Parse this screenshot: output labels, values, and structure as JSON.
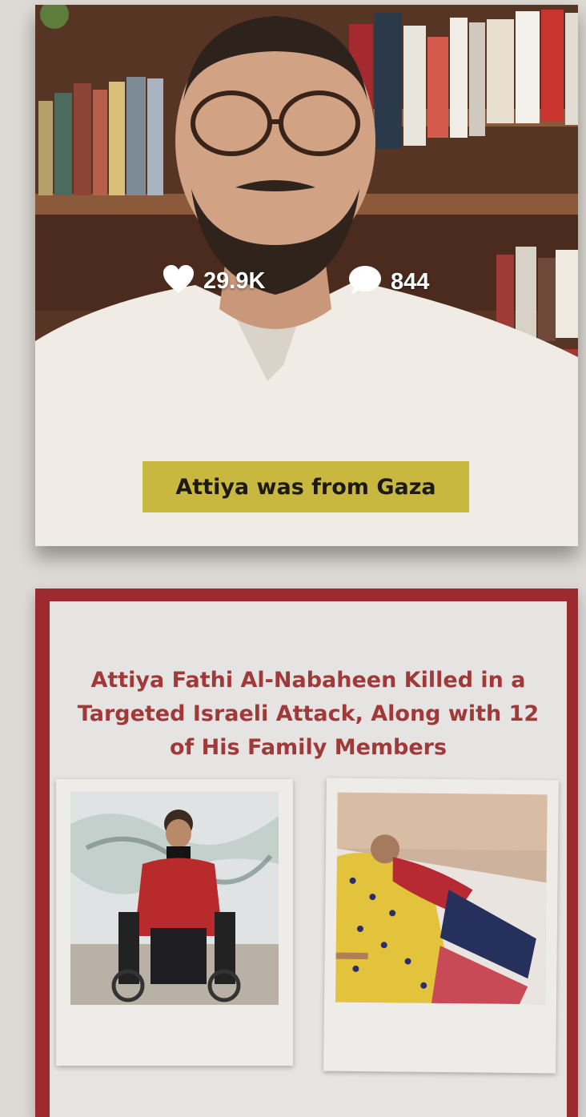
{
  "video": {
    "likes": "29.9K",
    "comments": "844",
    "caption": "Attiya was from Gaza",
    "icons": [
      "heart-icon",
      "comment-bubble-icon"
    ]
  },
  "news": {
    "headline": "Attiya Fathi Al-Nabaheen Killed in a Targeted Israeli Attack, Along with 12 of His Family Members"
  },
  "colors": {
    "caption_bg": "#c9b840",
    "card_border": "#9c2a2f",
    "headline_text": "#a0393a"
  }
}
